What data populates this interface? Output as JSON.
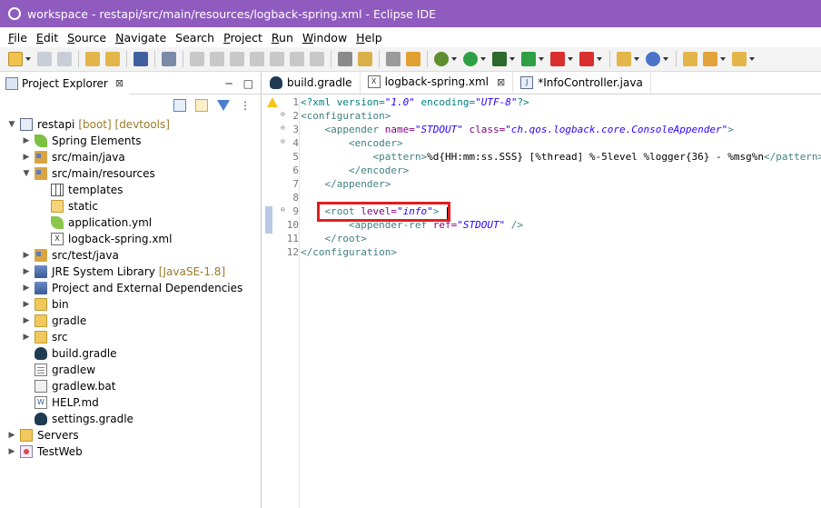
{
  "window": {
    "title": "workspace - restapi/src/main/resources/logback-spring.xml - Eclipse IDE"
  },
  "menu": [
    {
      "label": "File",
      "mnemonic": "F",
      "rest": "ile"
    },
    {
      "label": "Edit",
      "mnemonic": "E",
      "rest": "dit"
    },
    {
      "label": "Source",
      "mnemonic": "S",
      "rest": "ource"
    },
    {
      "label": "Navigate",
      "mnemonic": "N",
      "rest": "avigate"
    },
    {
      "label": "Search",
      "mnemonic": "",
      "rest": "Search"
    },
    {
      "label": "Project",
      "mnemonic": "P",
      "rest": "roject"
    },
    {
      "label": "Run",
      "mnemonic": "R",
      "rest": "un"
    },
    {
      "label": "Window",
      "mnemonic": "W",
      "rest": "indow"
    },
    {
      "label": "Help",
      "mnemonic": "H",
      "rest": "elp"
    }
  ],
  "project_explorer": {
    "tab_label": "Project Explorer",
    "close": "⊠"
  },
  "tree": [
    {
      "label": "restapi",
      "decor": "[boot] [devtools]"
    },
    {
      "label": "Spring Elements"
    },
    {
      "label": "src/main/java"
    },
    {
      "label": "src/main/resources"
    },
    {
      "label": "templates"
    },
    {
      "label": "static"
    },
    {
      "label": "application.yml"
    },
    {
      "label": "logback-spring.xml"
    },
    {
      "label": "src/test/java"
    },
    {
      "label": "JRE System Library",
      "decor": "[JavaSE-1.8]"
    },
    {
      "label": "Project and External Dependencies"
    },
    {
      "label": "bin"
    },
    {
      "label": "gradle"
    },
    {
      "label": "src"
    },
    {
      "label": "build.gradle"
    },
    {
      "label": "gradlew"
    },
    {
      "label": "gradlew.bat"
    },
    {
      "label": "HELP.md"
    },
    {
      "label": "settings.gradle"
    },
    {
      "label": "Servers"
    },
    {
      "label": "TestWeb"
    }
  ],
  "editor_tabs": [
    {
      "label": "build.gradle"
    },
    {
      "label": "logback-spring.xml",
      "close": "⊠"
    },
    {
      "label": "*InfoController.java"
    }
  ],
  "code": {
    "line_numbers": [
      "1",
      "2",
      "3",
      "4",
      "5",
      "6",
      "7",
      "8",
      "9",
      "10",
      "11",
      "12"
    ],
    "l1_a": "<?xml version=",
    "l1_b": "\"1.0\"",
    "l1_c": " encoding=",
    "l1_d": "\"UTF-8\"",
    "l1_e": "?>",
    "l2_a": "<configuration>",
    "l3_a": "    <appender",
    "l3_b": " name=",
    "l3_c": "\"STDOUT\"",
    "l3_d": " class=",
    "l3_e": "\"ch.qos.logback.core.ConsoleAppender\"",
    "l3_f": ">",
    "l4_a": "        <encoder>",
    "l5_a": "            <pattern>",
    "l5_b": "%d{HH:mm:ss.SSS} [%thread] %-5level %logger{36} - %msg%n",
    "l5_c": "</pattern>",
    "l6_a": "        </encoder>",
    "l7_a": "    </appender>",
    "l9_a": "    <root",
    "l9_b": " level=",
    "l9_c": "\"info\"",
    "l9_d": ">",
    "l10_a": "        <appender-ref",
    "l10_b": " ref=",
    "l10_c": "\"STDOUT\"",
    "l10_d": " />",
    "l11_a": "    </root>",
    "l12_a": "</configuration>"
  }
}
